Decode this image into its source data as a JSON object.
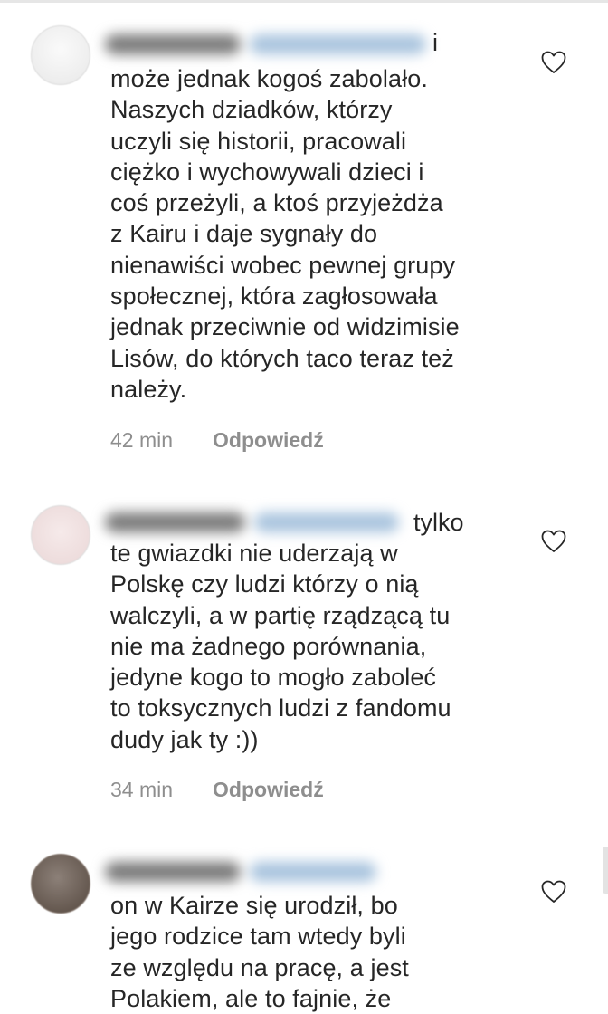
{
  "comments": [
    {
      "lead_word": "i",
      "lines": [
        "może jednak kogoś zabolało.",
        "Naszych dziadków, którzy",
        "uczyli się historii, pracowali",
        "ciężko i wychowywali dzieci i",
        "coś przeżyli, a ktoś przyjeżdża",
        "z Kairu i daje sygnały do",
        "nienawiści wobec pewnej grupy",
        "społecznej, która zagłosowała",
        "jednak przeciwnie od widzimisie",
        "Lisów, do których taco teraz też",
        "należy."
      ],
      "time": "42 min",
      "reply_label": "Odpowiedź",
      "avatar_color": "#f2f2f2"
    },
    {
      "lead_word": "tylko",
      "lines": [
        "te gwiazdki nie uderzają w",
        "Polskę czy ludzi którzy o nią",
        "walczyli, a w partię rządzącą tu",
        "nie ma żadnego porównania,",
        "jedyne kogo to mogło zaboleć",
        "to toksycznych ludzi z fandomu",
        "dudy jak ty :))"
      ],
      "time": "34 min",
      "reply_label": "Odpowiedź",
      "avatar_color": "#f0e2e2"
    },
    {
      "lead_word": "",
      "lines": [
        "on w Kairze się urodził, bo",
        "jego rodzice tam wtedy byli",
        "ze względu na pracę, a jest",
        "Polakiem, ale to fajnie, że"
      ],
      "time": "",
      "reply_label": "",
      "avatar_color": "#6f625a"
    }
  ],
  "icons": {
    "like": "heart-outline-icon"
  },
  "colors": {
    "text": "#262626",
    "meta": "#8e8e8e",
    "username_blur": "#7a7a7a",
    "mention_blur": "#a9c4de"
  }
}
